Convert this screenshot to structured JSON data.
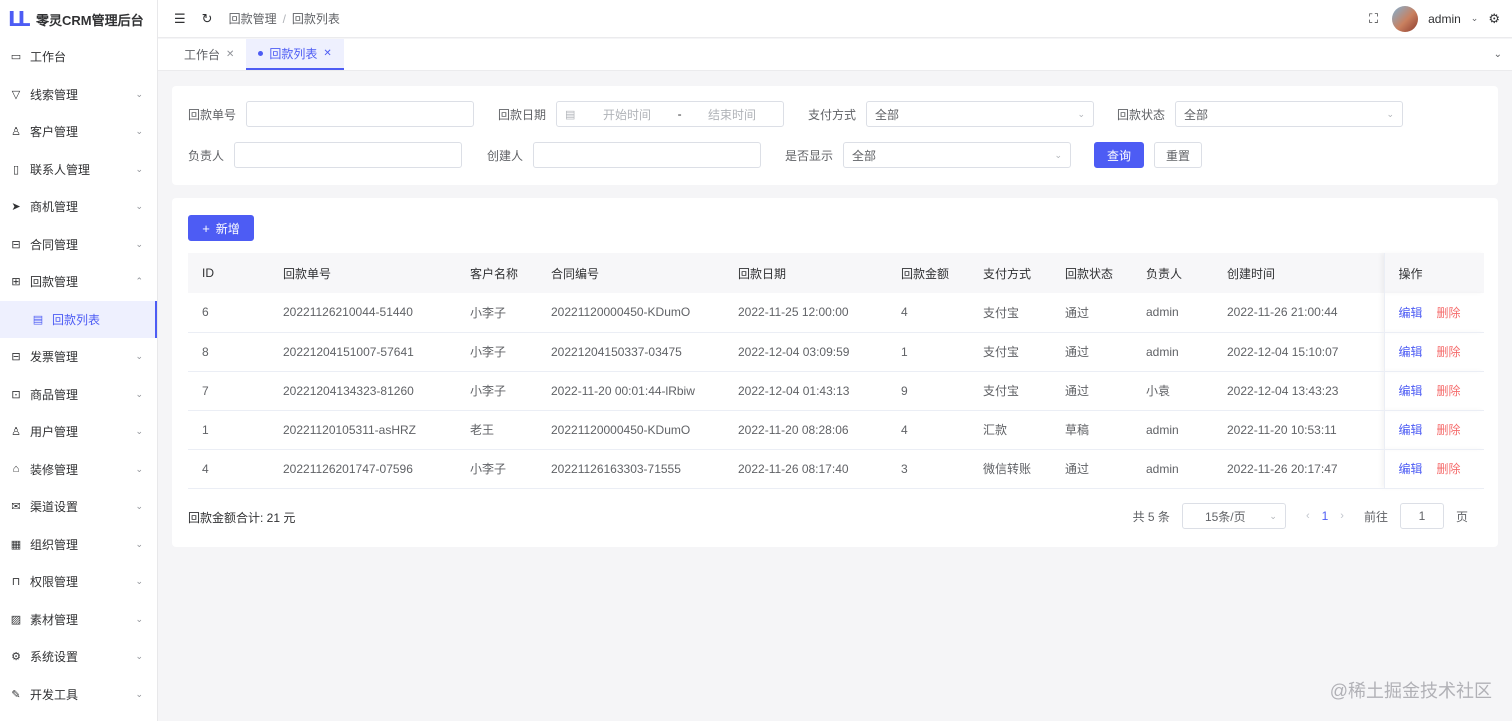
{
  "app": {
    "title": "零灵CRM管理后台",
    "logo_text": "LL"
  },
  "sidebar": {
    "items": [
      {
        "label": "工作台",
        "icon": "monitor-icon",
        "glyph": "▭",
        "chevron": ""
      },
      {
        "label": "线索管理",
        "icon": "funnel-icon",
        "glyph": "▽",
        "chevron": "⌄"
      },
      {
        "label": "客户管理",
        "icon": "user-icon",
        "glyph": "♙",
        "chevron": "⌄"
      },
      {
        "label": "联系人管理",
        "icon": "book-icon",
        "glyph": "▯",
        "chevron": "⌄"
      },
      {
        "label": "商机管理",
        "icon": "send-icon",
        "glyph": "➤",
        "chevron": "⌄"
      },
      {
        "label": "合同管理",
        "icon": "briefcase-icon",
        "glyph": "⊟",
        "chevron": "⌄"
      },
      {
        "label": "回款管理",
        "icon": "wallet-icon",
        "glyph": "⊞",
        "chevron": "⌃"
      },
      {
        "label": "回款列表",
        "icon": "document-icon",
        "glyph": "▤",
        "chevron": "",
        "sub": true
      },
      {
        "label": "发票管理",
        "icon": "invoice-icon",
        "glyph": "⊟",
        "chevron": "⌄"
      },
      {
        "label": "商品管理",
        "icon": "box-icon",
        "glyph": "⊡",
        "chevron": "⌄"
      },
      {
        "label": "用户管理",
        "icon": "person-icon",
        "glyph": "♙",
        "chevron": "⌄"
      },
      {
        "label": "装修管理",
        "icon": "store-icon",
        "glyph": "⌂",
        "chevron": "⌄"
      },
      {
        "label": "渠道设置",
        "icon": "mail-icon",
        "glyph": "✉",
        "chevron": "⌄"
      },
      {
        "label": "组织管理",
        "icon": "building-icon",
        "glyph": "▦",
        "chevron": "⌄"
      },
      {
        "label": "权限管理",
        "icon": "lock-icon",
        "glyph": "⊓",
        "chevron": "⌄"
      },
      {
        "label": "素材管理",
        "icon": "image-icon",
        "glyph": "▨",
        "chevron": "⌄"
      },
      {
        "label": "系统设置",
        "icon": "gear-icon",
        "glyph": "⚙",
        "chevron": "⌄"
      },
      {
        "label": "开发工具",
        "icon": "pen-icon",
        "glyph": "✎",
        "chevron": "⌄"
      }
    ]
  },
  "header": {
    "breadcrumb": [
      "回款管理",
      "回款列表"
    ],
    "breadcrumb_sep": "/",
    "user_name": "admin"
  },
  "tabs": [
    {
      "label": "工作台",
      "active": false
    },
    {
      "label": "回款列表",
      "active": true
    }
  ],
  "filters": {
    "order_no_label": "回款单号",
    "date_label": "回款日期",
    "date_start_placeholder": "开始时间",
    "date_sep": "-",
    "date_end_placeholder": "结束时间",
    "pay_method_label": "支付方式",
    "pay_method_value": "全部",
    "status_label": "回款状态",
    "status_value": "全部",
    "owner_label": "负责人",
    "creator_label": "创建人",
    "visible_label": "是否显示",
    "visible_value": "全部",
    "query_label": "查询",
    "reset_label": "重置"
  },
  "list": {
    "add_label": "新增",
    "columns": [
      "ID",
      "回款单号",
      "客户名称",
      "合同编号",
      "回款日期",
      "回款金额",
      "支付方式",
      "回款状态",
      "负责人",
      "创建时间",
      "操作"
    ],
    "rows": [
      {
        "id": "6",
        "no": "20221126210044-51440",
        "customer": "小李子",
        "contract": "20221120000450-KDumO",
        "date": "2022-11-25 12:00:00",
        "amount": "4",
        "method": "支付宝",
        "status": "通过",
        "owner": "admin",
        "created": "2022-11-26 21:00:44"
      },
      {
        "id": "8",
        "no": "20221204151007-57641",
        "customer": "小李子",
        "contract": "20221204150337-03475",
        "date": "2022-12-04 03:09:59",
        "amount": "1",
        "method": "支付宝",
        "status": "通过",
        "owner": "admin",
        "created": "2022-12-04 15:10:07"
      },
      {
        "id": "7",
        "no": "20221204134323-81260",
        "customer": "小李子",
        "contract": "2022-11-20 00:01:44-lRbiw",
        "date": "2022-12-04 01:43:13",
        "amount": "9",
        "method": "支付宝",
        "status": "通过",
        "owner": "小袁",
        "created": "2022-12-04 13:43:23"
      },
      {
        "id": "1",
        "no": "20221120105311-asHRZ",
        "customer": "老王",
        "contract": "20221120000450-KDumO",
        "date": "2022-11-20 08:28:06",
        "amount": "4",
        "method": "汇款",
        "status": "草稿",
        "owner": "admin",
        "created": "2022-11-20 10:53:11"
      },
      {
        "id": "4",
        "no": "20221126201747-07596",
        "customer": "小李子",
        "contract": "20221126163303-71555",
        "date": "2022-11-26 08:17:40",
        "amount": "3",
        "method": "微信转账",
        "status": "通过",
        "owner": "admin",
        "created": "2022-11-26 20:17:47"
      }
    ],
    "edit_label": "编辑",
    "delete_label": "删除",
    "total_text": "回款金额合计: 21 元"
  },
  "pagination": {
    "total_text": "共 5 条",
    "page_size": "15条/页",
    "current_page": "1",
    "goto_label": "前往",
    "goto_value": "1",
    "page_suffix": "页"
  },
  "watermark": "@稀土掘金技术社区",
  "colors": {
    "primary": "#4d5cf4",
    "danger": "#f56c6c"
  }
}
